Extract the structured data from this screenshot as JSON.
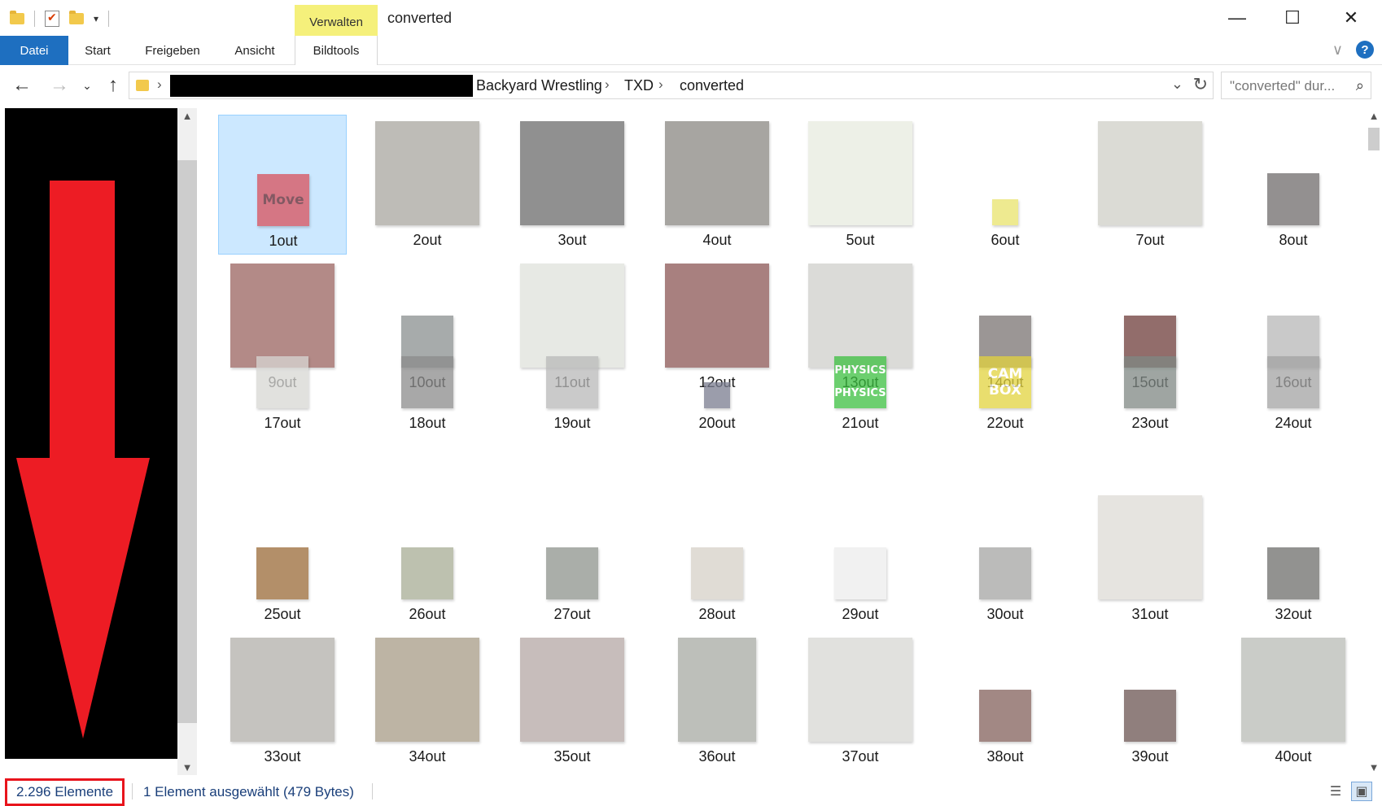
{
  "window": {
    "title": "converted",
    "context_tab": "Verwalten",
    "minimize": "—",
    "maximize": "☐",
    "close": "✕"
  },
  "ribbon": {
    "tabs": [
      {
        "label": "Datei"
      },
      {
        "label": "Start"
      },
      {
        "label": "Freigeben"
      },
      {
        "label": "Ansicht"
      },
      {
        "label": "Bildtools"
      }
    ],
    "help": "?"
  },
  "address": {
    "crumbs": [
      "Backyard Wrestling",
      "TXD",
      "converted"
    ],
    "search_placeholder": "\"converted\" dur..."
  },
  "files": [
    {
      "name": "1out",
      "text": "Move",
      "color": "#d9515c"
    },
    {
      "name": "2out",
      "color": "#a9a69f"
    },
    {
      "name": "3out",
      "color": "#6c6c6c"
    },
    {
      "name": "4out",
      "color": "#8a8882"
    },
    {
      "name": "5out",
      "color": "#e8ebe0"
    },
    {
      "name": "6out",
      "color": "#e9e36c"
    },
    {
      "name": "7out",
      "color": "#cfcfc8"
    },
    {
      "name": "8out",
      "color": "#6f6b6b"
    },
    {
      "name": "9out",
      "color": "#9a6460"
    },
    {
      "name": "10out",
      "color": "#8a9090"
    },
    {
      "name": "11out",
      "color": "#dfe2dc"
    },
    {
      "name": "12out",
      "color": "#8b5655"
    },
    {
      "name": "13out",
      "color": "#cfcfcc"
    },
    {
      "name": "14out",
      "color": "#7a7472"
    },
    {
      "name": "15out",
      "color": "#6e3d3a"
    },
    {
      "name": "16out",
      "color": "#b7b7b7"
    },
    {
      "name": "17out",
      "color": "#d7d7d4"
    },
    {
      "name": "18out",
      "color": "#8b8b8b"
    },
    {
      "name": "19out",
      "color": "#b9b9b9"
    },
    {
      "name": "20out",
      "color": "#7a7d90"
    },
    {
      "name": "21out",
      "text": "PHYSICS PHYSICS",
      "color": "#3bbf3f"
    },
    {
      "name": "22out",
      "text": "CAM BOX",
      "color": "#e2d33e"
    },
    {
      "name": "23out",
      "color": "#7f8884"
    },
    {
      "name": "24out",
      "color": "#a3a3a3"
    },
    {
      "name": "25out",
      "color": "#9a6a38"
    },
    {
      "name": "26out",
      "color": "#a7ad95"
    },
    {
      "name": "27out",
      "color": "#8e948d"
    },
    {
      "name": "28out",
      "color": "#d6d1c7"
    },
    {
      "name": "29out",
      "color": "#ededed"
    },
    {
      "name": "30out",
      "color": "#a5a5a3"
    },
    {
      "name": "31out",
      "color": "#dedcd6"
    },
    {
      "name": "32out",
      "color": "#6e6e6c"
    },
    {
      "name": "33out",
      "color": "#b2b0aa"
    },
    {
      "name": "34out",
      "color": "#a89c86"
    },
    {
      "name": "35out",
      "color": "#b5a8a5"
    },
    {
      "name": "36out",
      "color": "#a7aaa4"
    },
    {
      "name": "37out",
      "color": "#d8d8d4"
    },
    {
      "name": "38out",
      "color": "#84615b"
    },
    {
      "name": "39out",
      "color": "#6c5552"
    },
    {
      "name": "40out",
      "color": "#b9bbb6"
    }
  ],
  "status": {
    "item_count": "2.296 Elemente",
    "selection": "1 Element ausgewählt (479 Bytes)"
  }
}
